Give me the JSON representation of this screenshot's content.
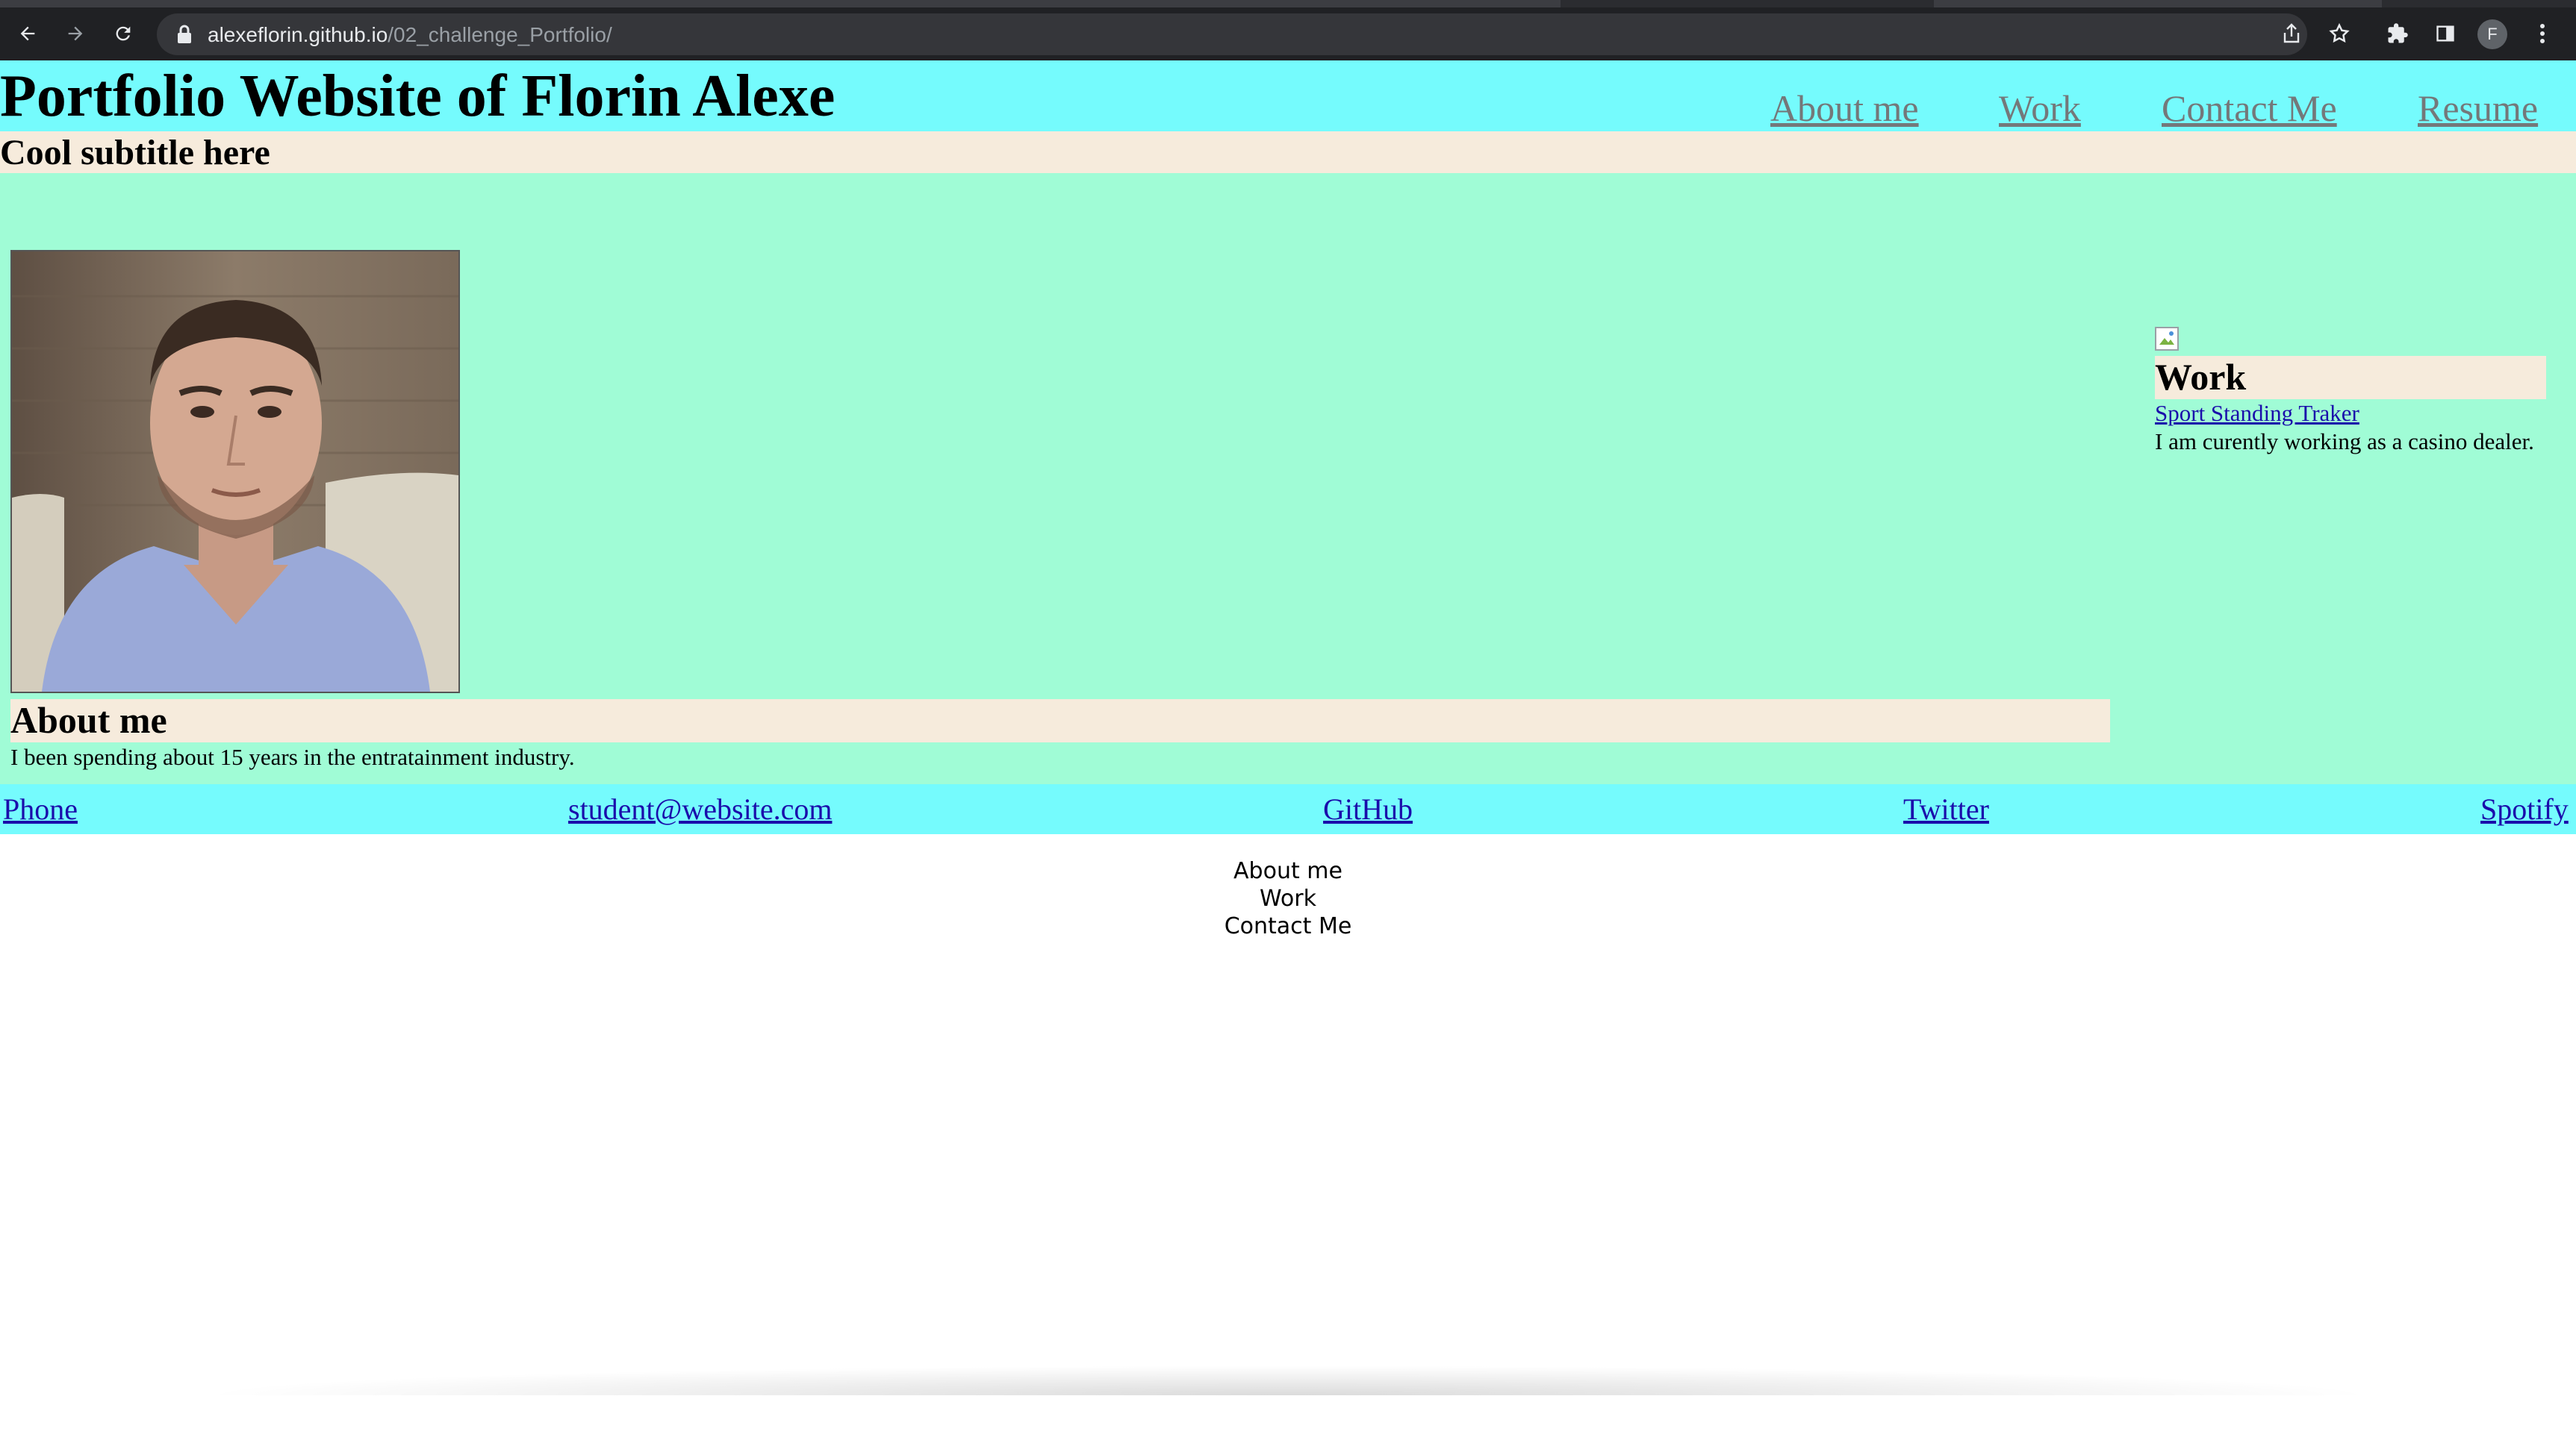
{
  "browser": {
    "url_host": "alexeflorin.github.io",
    "url_path": "/02_challenge_Portfolio/",
    "avatar_initial": "F",
    "icons": [
      "back-arrow-icon",
      "forward-arrow-icon",
      "reload-icon",
      "lock-icon",
      "share-icon",
      "bookmark-star-icon",
      "extensions-puzzle-icon",
      "side-panel-icon",
      "kebab-menu-icon"
    ]
  },
  "header": {
    "title": "Portfolio Website of Florin Alexe",
    "nav": [
      "About me",
      "Work",
      "Contact Me",
      "Resume"
    ]
  },
  "subtitle": "Cool subtitle here",
  "about": {
    "heading": "About me",
    "text": "I been spending about 15 years in the entratainment industry."
  },
  "work": {
    "heading": "Work",
    "link": "Sport Standing Traker",
    "text": "I am curently working as a casino dealer."
  },
  "footer": {
    "links": [
      "Phone",
      "student@website.com",
      "GitHub",
      "Twitter",
      "Spotify"
    ]
  },
  "bottom_nav": [
    "About me",
    "Work",
    "Contact Me"
  ],
  "colors": {
    "header_bg": "#75fbfd",
    "subtitle_bg": "#f6ebdc",
    "content_bg": "#a0fcd6",
    "link": "#1a0dab",
    "nav_link": "#74787a"
  }
}
